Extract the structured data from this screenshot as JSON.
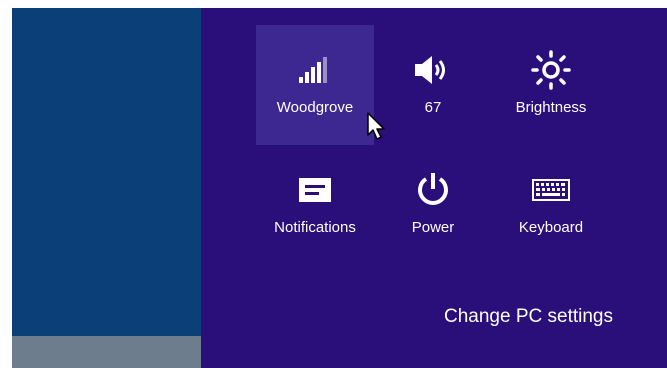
{
  "settings_charm": {
    "quick_settings": [
      {
        "id": "network",
        "label": "Woodgrove",
        "icon": "signal-bars-icon",
        "highlighted": true
      },
      {
        "id": "volume",
        "label": "67",
        "icon": "speaker-icon",
        "highlighted": false
      },
      {
        "id": "brightness",
        "label": "Brightness",
        "icon": "sun-icon",
        "highlighted": false
      },
      {
        "id": "notifications",
        "label": "Notifications",
        "icon": "message-icon",
        "highlighted": false
      },
      {
        "id": "power",
        "label": "Power",
        "icon": "power-icon",
        "highlighted": false
      },
      {
        "id": "keyboard",
        "label": "Keyboard",
        "icon": "keyboard-icon",
        "highlighted": false
      }
    ],
    "change_pc_settings_label": "Change PC settings"
  },
  "colors": {
    "panel_bg": "#2a0f7a",
    "tile_highlight": "#3d2891",
    "desktop_bg": "#0b3f78",
    "text": "#ffffff"
  }
}
